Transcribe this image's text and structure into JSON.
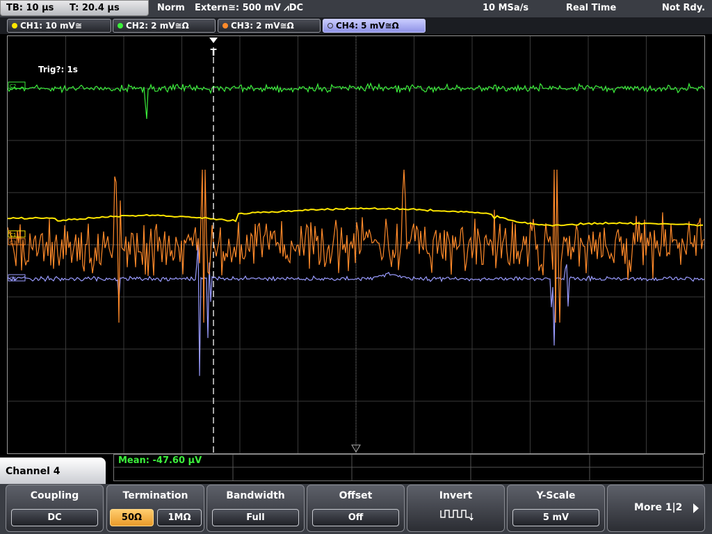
{
  "topbar": {
    "timebase": "TB: 10 µs",
    "trigger_time": "T: 20.4 µs",
    "mode": "Norm",
    "trigger_source": "Extern≅: 500 mV ⩘DC",
    "sample_rate": "10 MSa/s",
    "acq_mode": "Real Time",
    "status": "Not Rdy."
  },
  "channels": [
    {
      "label": "CH1: 10 mV≅",
      "color": "#ffe600"
    },
    {
      "label": "CH2: 2 mV≅Ω",
      "color": "#3cf03c"
    },
    {
      "label": "CH3: 2 mV≅Ω",
      "color": "#ff8a2a"
    },
    {
      "label": "CH4: 5 mV≅Ω",
      "color": "#9a9cff",
      "active": true
    }
  ],
  "display": {
    "trigger_readout": "Trig?: 1s",
    "trigger_marker": "T",
    "ch_markers": [
      "C2",
      "C1",
      "C3",
      "C4"
    ]
  },
  "measurement": {
    "text": "Mean: -47.60 µV"
  },
  "panel": {
    "title": "Channel 4"
  },
  "softkeys": {
    "coupling": {
      "title": "Coupling",
      "value": "DC"
    },
    "termination": {
      "title": "Termination",
      "option_a": "50Ω",
      "option_b": "1MΩ",
      "selected": "50Ω"
    },
    "bandwidth": {
      "title": "Bandwidth",
      "value": "Full"
    },
    "offset": {
      "title": "Offset",
      "value": "Off"
    },
    "invert": {
      "title": "Invert",
      "icon": "invert-waveform-icon"
    },
    "yscale": {
      "title": "Y-Scale",
      "value": "5 mV"
    },
    "more": {
      "label": "More 1|2"
    }
  },
  "colors": {
    "grid": "#3a3a3a",
    "ch1": "#ffe600",
    "ch2": "#3cf03c",
    "ch3": "#ff8a2a",
    "ch4": "#9a9cff"
  }
}
